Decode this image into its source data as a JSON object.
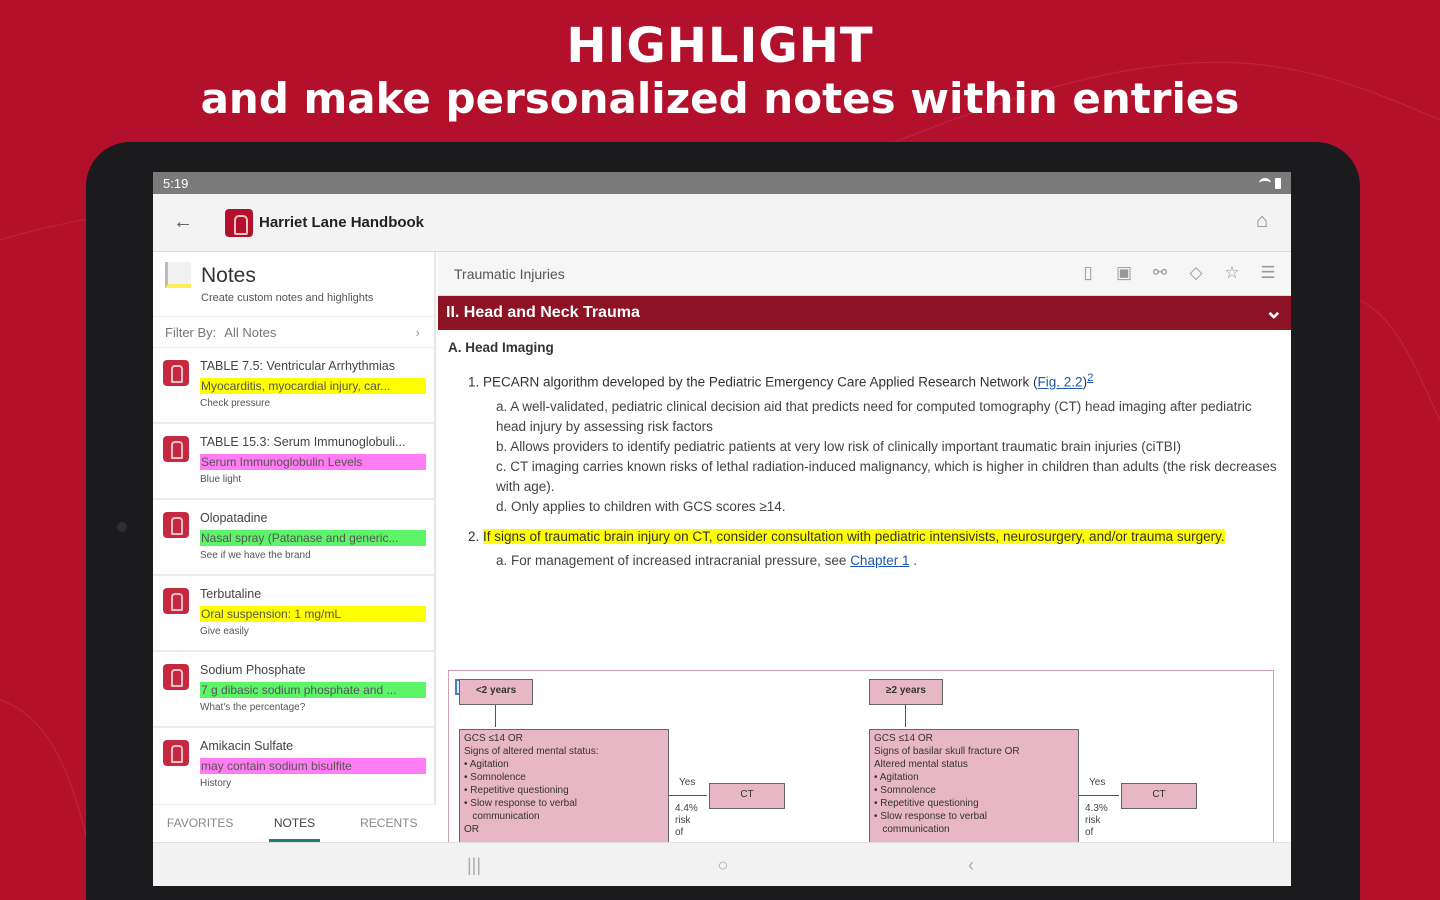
{
  "headline": {
    "line1": "HIGHLIGHT",
    "line2": "and make personalized notes within entries"
  },
  "status_bar": {
    "time": "5:19"
  },
  "app_bar": {
    "back_icon": "arrow-left-icon",
    "title": "Harriet Lane Handbook",
    "home_icon": "home-icon"
  },
  "notes_panel": {
    "title": "Notes",
    "subtitle": "Create custom notes and highlights",
    "filter_label": "Filter By:",
    "filter_value": "All Notes",
    "items": [
      {
        "title": "TABLE 7.5: Ventricular Arrhythmias",
        "highlight": "Myocarditis, myocardial injury, car...",
        "color": "yellow",
        "note": "Check pressure"
      },
      {
        "title": "TABLE 15.3: Serum Immunoglobuli...",
        "highlight": "Serum Immunoglobulin Levels",
        "color": "pink",
        "note": "Blue light"
      },
      {
        "title": "Olopatadine",
        "highlight": "Nasal spray (Patanase and generic...",
        "color": "green",
        "note": "See if we have the brand"
      },
      {
        "title": "Terbutaline",
        "highlight": "Oral suspension: 1 mg/mL",
        "color": "yellow",
        "note": "Give easily"
      },
      {
        "title": "Sodium Phosphate",
        "highlight": "7 g dibasic sodium phosphate and ...",
        "color": "green",
        "note": "What's the percentage?"
      },
      {
        "title": "Amikacin Sulfate",
        "highlight": "may contain sodium bisulfite",
        "color": "pink",
        "note": "History"
      }
    ],
    "tabs": [
      "FAVORITES",
      "NOTES",
      "RECENTS"
    ],
    "active_tab": "NOTES"
  },
  "document": {
    "title": "Traumatic Injuries",
    "tool_icons": [
      "document-icon",
      "save-icon",
      "link-icon",
      "tag-icon",
      "star-icon",
      "list-icon"
    ],
    "section": "II. Head and Neck Trauma",
    "subhead": "A. Head Imaging",
    "item1_prefix": "1. PECARN algorithm developed by the Pediatric Emergency Care Applied Research Network (",
    "item1_link": "Fig. 2.2",
    "item1_suffix": ")",
    "item1_sup": "2",
    "sub_a": "a. A well-validated, pediatric clinical decision aid that predicts need for computed tomography (CT) head imaging after pediatric head injury by assessing risk factors",
    "sub_b": "b. Allows providers to identify pediatric patients at very low risk of clinically important traumatic brain injuries (ciTBI)",
    "sub_c": "c. CT imaging carries known risks of lethal radiation-induced malignancy, which is higher in children than adults (the risk decreases with age).",
    "sub_d": "d. Only applies to children with GCS scores ≥14.",
    "item2_num": "2.",
    "item2_highlight": "If signs of traumatic brain injury on CT, consider consultation with pediatric intensivists, neurosurgery, and/or trauma surgery.",
    "item2a_prefix": "a. For management of increased intracranial pressure, see ",
    "item2a_link": "Chapter 1",
    "item2a_suffix": " ."
  },
  "figure": {
    "left_age": "<2 years",
    "left_box": "GCS ≤14 OR\nSigns of altered mental status:\n• Agitation\n• Somnolence\n• Repetitive questioning\n• Slow response to verbal\n   communication\nOR",
    "left_yes": "Yes",
    "left_risk": "4.4%\nrisk\nof",
    "left_ct": "CT",
    "right_age": "≥2 years",
    "right_box": "GCS ≤14 OR\nSigns of basilar skull fracture OR\nAltered mental status\n• Agitation\n• Somnolence\n• Repetitive questioning\n• Slow response to verbal\n   communication",
    "right_yes": "Yes",
    "right_risk": "4.3%\nrisk\nof",
    "right_ct": "CT"
  },
  "colors": {
    "background": "#b3102c",
    "section_bar": "#8c1224",
    "highlight_yellow": "#ffff00",
    "highlight_green": "#5ef46a",
    "highlight_pink": "#ff7cf2",
    "active_tab_underline": "#1d7f6f"
  }
}
